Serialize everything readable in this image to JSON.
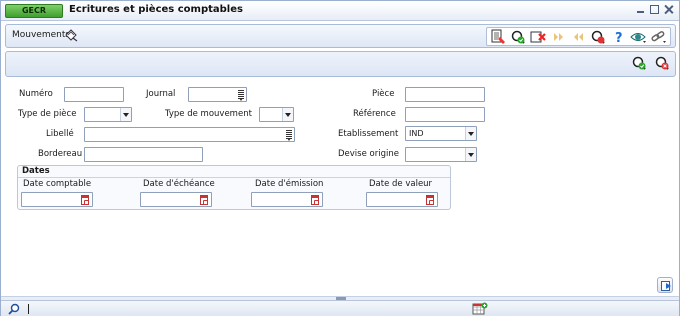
{
  "app": {
    "badge": "GECR",
    "title": "Ecritures et pièces comptables"
  },
  "toolbar": {
    "menu_label": "Mouvements",
    "buttons": [
      "new-entry",
      "search",
      "delete",
      "next",
      "previous",
      "filter",
      "help",
      "view",
      "link"
    ]
  },
  "form": {
    "numero_label": "Numéro",
    "journal_label": "Journal",
    "piece_label": "Pièce",
    "type_piece_label": "Type de pièce",
    "type_mouvement_label": "Type de mouvement",
    "reference_label": "Référence",
    "libelle_label": "Libellé",
    "etablissement_label": "Etablissement",
    "etablissement_value": "IND",
    "bordereau_label": "Bordereau",
    "devise_label": "Devise origine"
  },
  "dates": {
    "title": "Dates",
    "comptable_label": "Date comptable",
    "echeance_label": "Date d'échéance",
    "emission_label": "Date d'émission",
    "valeur_label": "Date de valeur"
  },
  "colors": {
    "accent": "#3f9f2e",
    "frame": "#a9bbd8",
    "toolbar_bg": "#dfe7f5"
  }
}
